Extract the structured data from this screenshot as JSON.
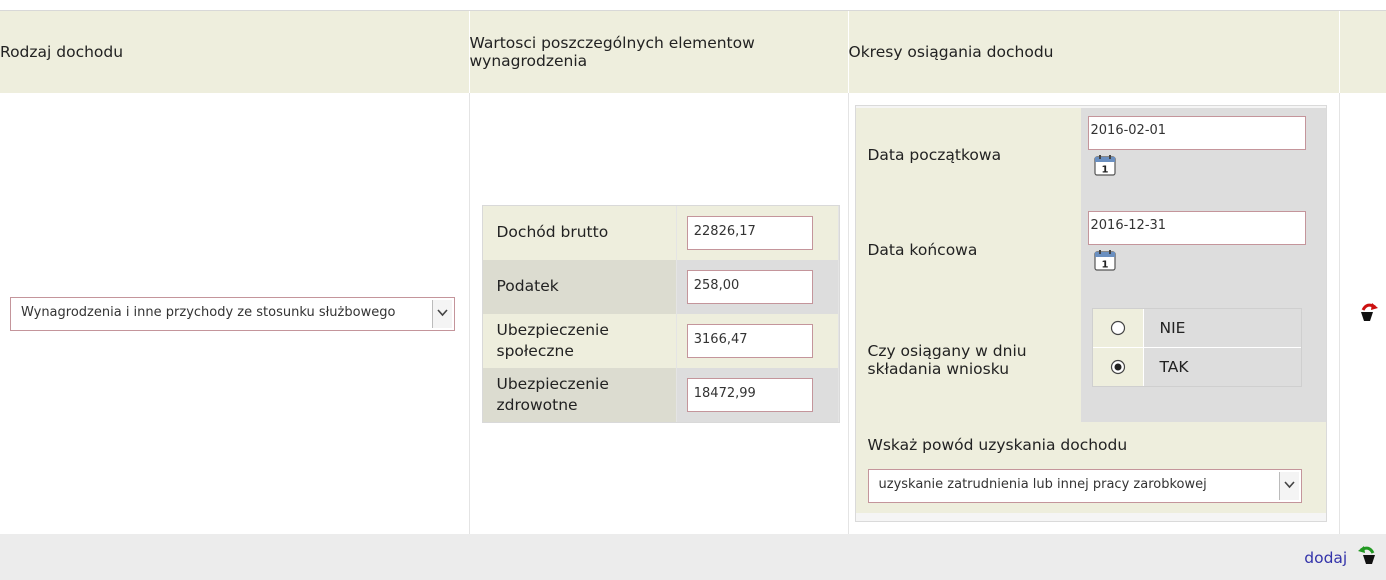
{
  "headers": {
    "income_type": "Rodzaj dochodu",
    "element_values": "Wartosci poszczególnych elementow wynagrodzenia",
    "income_periods": "Okresy osiągania dochodu"
  },
  "income_type_select": {
    "value": "Wynagrodzenia i inne przychody ze stosunku służbowego"
  },
  "elements": [
    {
      "label": "Dochód brutto",
      "value": "22826,17"
    },
    {
      "label": "Podatek",
      "value": "258,00"
    },
    {
      "label": "Ubezpieczenie społeczne",
      "value": "3166,47"
    },
    {
      "label": "Ubezpieczenie zdrowotne",
      "value": "18472,99"
    }
  ],
  "periods": {
    "start_label": "Data początkowa",
    "start_value": "2016-02-01",
    "end_label": "Data końcowa",
    "end_value": "2016-12-31",
    "achieved_label": "Czy osiągany w dniu składania wniosku",
    "options": [
      {
        "label": "NIE",
        "selected": false
      },
      {
        "label": "TAK",
        "selected": true
      }
    ],
    "reason_label": "Wskaż powód uzyskania dochodu",
    "reason_value": "uzyskanie zatrudnienia lub innej pracy zarobkowej",
    "calendar_day": "1"
  },
  "footer": {
    "add_label": "dodaj"
  },
  "icons": {
    "remove": "remove-row-icon",
    "add": "add-row-icon",
    "calendar": "calendar-icon"
  },
  "colors": {
    "header_bg": "#eeeedd",
    "input_border": "#c4959b",
    "link": "#3333aa",
    "remove_icon": "#cc1111",
    "add_icon": "#229922"
  }
}
